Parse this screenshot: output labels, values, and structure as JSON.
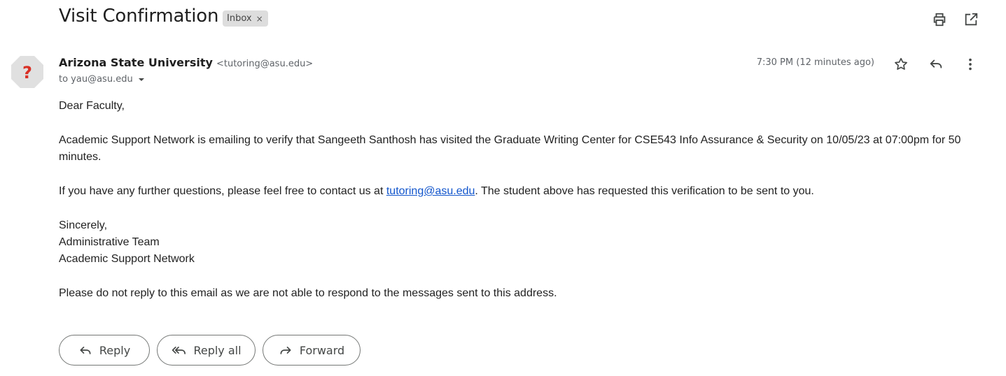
{
  "email": {
    "subject": "Visit Confirmation",
    "label_chip": "Inbox",
    "chip_close": "×",
    "sender_name": "Arizona State University",
    "sender_email": "<tutoring@asu.edu>",
    "recipient": "to yau@asu.edu",
    "timestamp": "7:30 PM (12 minutes ago)",
    "avatar_glyph": "?",
    "body": {
      "greeting": "Dear Faculty,",
      "para1": "Academic Support Network is emailing to verify that Sangeeth Santhosh has visited the Graduate Writing Center for CSE543 Info Assurance & Security on 10/05/23 at 07:00pm for 50 minutes.",
      "para2_before": "If you have any further questions, please feel free to contact us at ",
      "para2_link": "tutoring@asu.edu",
      "para2_after": ". The student above has requested this verification to be sent to you.",
      "sign1": "Sincerely,",
      "sign2": "Administrative Team",
      "sign3": "Academic Support Network",
      "footer": "Please do not reply to this email as we are not able to respond to the messages sent to this address."
    }
  },
  "actions": {
    "reply": "Reply",
    "reply_all": "Reply all",
    "forward": "Forward"
  },
  "icons": {
    "print": "print-icon",
    "open_new_window": "open-in-new-window-icon",
    "star": "star-icon",
    "reply": "reply-icon",
    "more": "more-vertical-icon",
    "dropdown": "caret-down-icon",
    "reply_all": "reply-all-icon",
    "forward": "forward-icon"
  },
  "colors": {
    "avatar_bg": "#e0e0e0",
    "avatar_glyph": "#d93025",
    "link": "#1155cc",
    "chip_bg": "#dddddd"
  }
}
